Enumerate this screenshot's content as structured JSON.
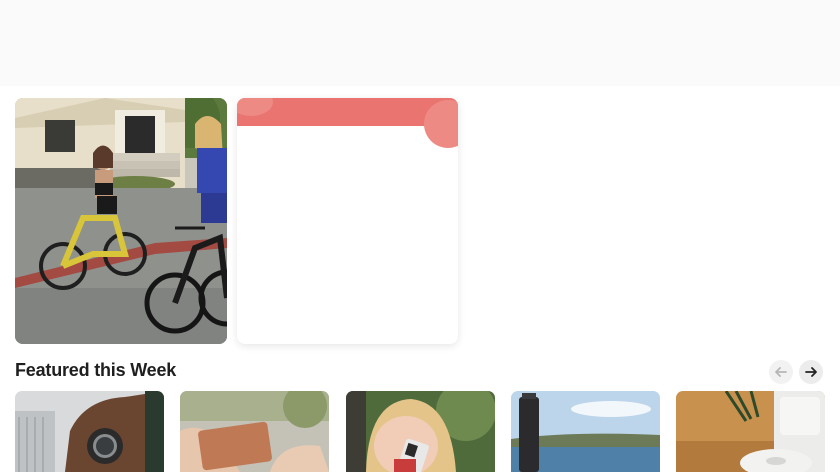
{
  "featured": {
    "title": "Featured this Week",
    "prev_icon": "arrow-left-icon",
    "next_icon": "arrow-right-icon",
    "products": [
      {
        "name": "smartwatch-on-wrist"
      },
      {
        "name": "wallet-in-hands"
      },
      {
        "name": "person-with-phone"
      },
      {
        "name": "thermos-at-lake"
      },
      {
        "name": "robot-vacuum-dock"
      }
    ]
  },
  "colors": {
    "card_band": "#e97470",
    "top_band": "#fafafa"
  }
}
